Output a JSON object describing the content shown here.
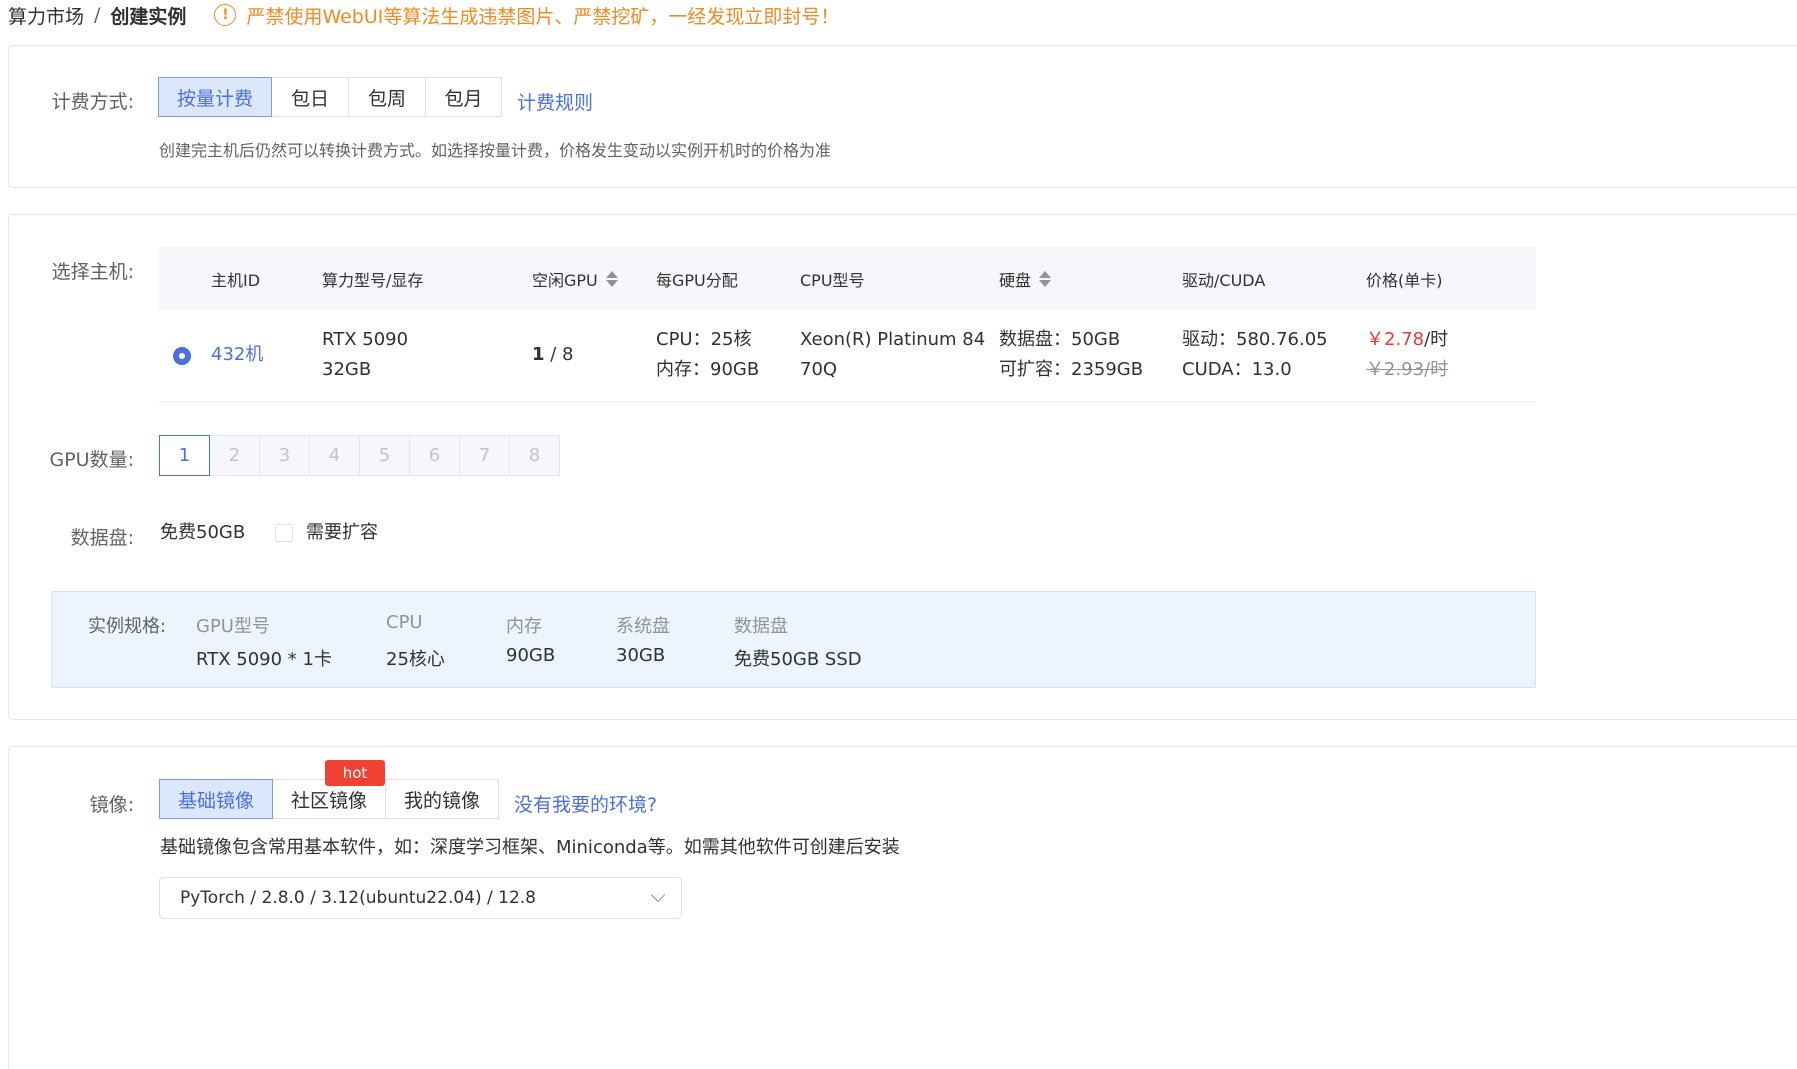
{
  "breadcrumb": {
    "parent": "算力市场",
    "separator": "/",
    "current": "创建实例"
  },
  "warning": {
    "icon": "warning-circle-icon",
    "text": "严禁使用WebUI等算法生成违禁图片、严禁挖矿，一经发现立即封号！"
  },
  "billing": {
    "label": "计费方式:",
    "options": [
      "按量计费",
      "包日",
      "包周",
      "包月"
    ],
    "selected": "按量计费",
    "rules_link": "计费规则",
    "hint": "创建完主机后仍然可以转换计费方式。如选择按量计费，价格发生变动以实例开机时的价格为准"
  },
  "host": {
    "label": "选择主机:",
    "columns": [
      "主机ID",
      "算力型号/显存",
      "空闲GPU",
      "每GPU分配",
      "CPU型号",
      "硬盘",
      "驱动/CUDA",
      "价格(单卡)"
    ],
    "row": {
      "id": "432机",
      "model": "RTX 5090",
      "vram": "32GB",
      "free_gpu": "1",
      "total_gpu": " / 8",
      "cpu_alloc": "CPU：25核",
      "mem_alloc": "内存：90GB",
      "cpu_model_1": "Xeon(R) Platinum 84",
      "cpu_model_2": "70Q",
      "disk": "数据盘：50GB",
      "disk_expand": "可扩容：2359GB",
      "driver": "驱动：580.76.05",
      "cuda": "CUDA：13.0",
      "price_now": "￥2.78",
      "price_now_unit": "/时",
      "price_old": "￥2.93/时"
    }
  },
  "gpu_count": {
    "label": "GPU数量:",
    "options": [
      "1",
      "2",
      "3",
      "4",
      "5",
      "6",
      "7",
      "8"
    ],
    "selected": "1"
  },
  "data_disk": {
    "label": "数据盘:",
    "free": "免费50GB",
    "expand_label": "需要扩容"
  },
  "spec": {
    "label": "实例规格:",
    "items": [
      {
        "key": "GPU型号",
        "value": "RTX 5090 * 1卡"
      },
      {
        "key": "CPU",
        "value": "25核心"
      },
      {
        "key": "内存",
        "value": "90GB"
      },
      {
        "key": "系统盘",
        "value": "30GB"
      },
      {
        "key": "数据盘",
        "value": "免费50GB SSD"
      }
    ]
  },
  "image": {
    "label": "镜像:",
    "tabs": [
      "基础镜像",
      "社区镜像",
      "我的镜像"
    ],
    "selected": "基础镜像",
    "hot_badge": "hot",
    "help_link": "没有我要的环境?",
    "hint": "基础镜像包含常用基本软件，如：深度学习框架、Miniconda等。如需其他软件可创建后安装",
    "select_value": "PyTorch / 2.8.0 / 3.12(ubuntu22.04) / 12.8"
  },
  "colors": {
    "primary": "#4c6fe0",
    "warning": "#f08a24",
    "price": "#e6383b",
    "hot": "#f04134"
  }
}
